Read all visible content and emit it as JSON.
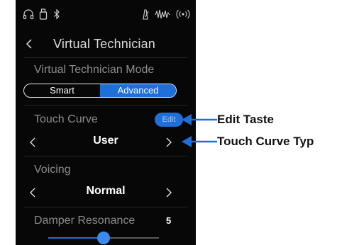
{
  "status_bar": {
    "icons": [
      "headphones-icon",
      "usb-drive-icon",
      "bluetooth-icon",
      "metronome-icon",
      "recorder-icon",
      "speaker-wave-icon"
    ]
  },
  "header": {
    "title": "Virtual Technician"
  },
  "mode": {
    "label": "Virtual Technician Mode",
    "options": [
      "Smart",
      "Advanced"
    ],
    "selected": "Advanced"
  },
  "touch_curve": {
    "label": "Touch Curve",
    "edit_label": "Edit",
    "value": "User"
  },
  "voicing": {
    "label": "Voicing",
    "value": "Normal"
  },
  "damper_resonance": {
    "label": "Damper Resonance",
    "value": "5",
    "level": 0.5
  },
  "callouts": {
    "edit": "Edit Taste",
    "type": "Touch Curve Typ"
  },
  "colors": {
    "accent": "#1f6fd8",
    "screen_bg": "#070707",
    "label_gray": "#8c8c8c"
  }
}
